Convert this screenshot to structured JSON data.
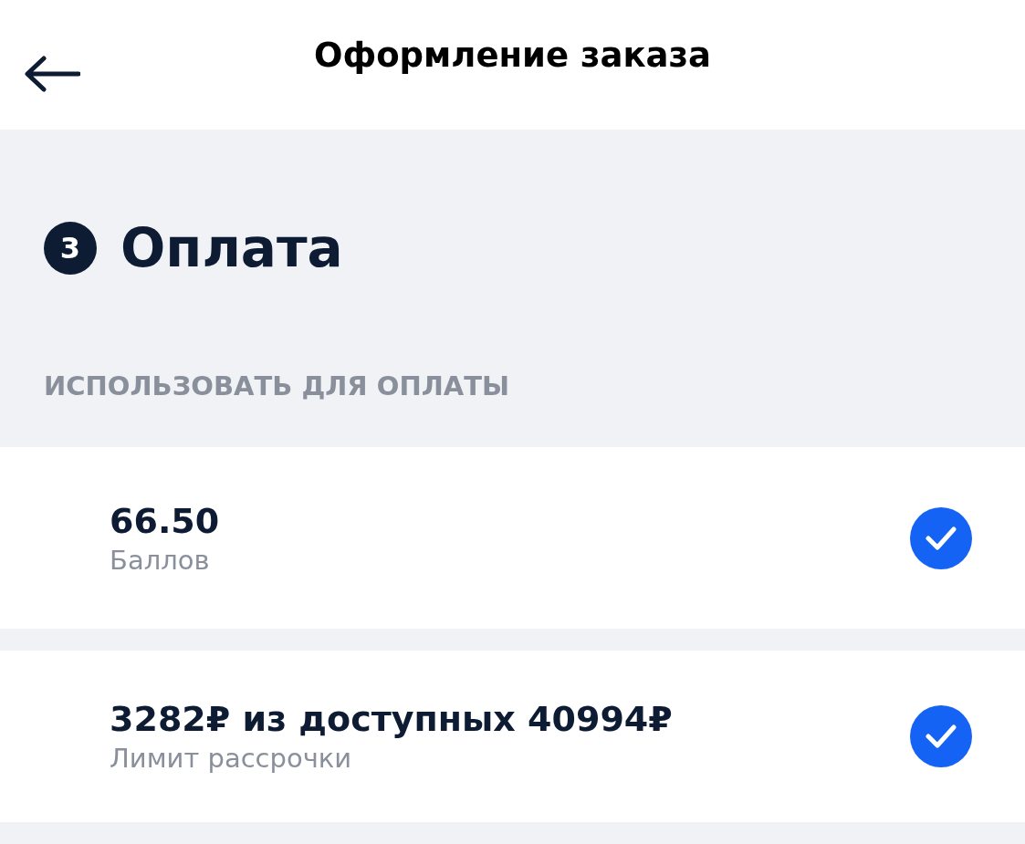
{
  "header": {
    "title": "Оформление заказа"
  },
  "step": {
    "number": "3",
    "title": "Оплата"
  },
  "section_label": "ИСПОЛЬЗОВАТЬ ДЛЯ ОПЛАТЫ",
  "options": [
    {
      "value": "66.50",
      "caption": "Баллов",
      "checked": true
    },
    {
      "value": "3282₽ из доступных 40994₽",
      "caption": "Лимит рассрочки",
      "checked": true
    }
  ]
}
